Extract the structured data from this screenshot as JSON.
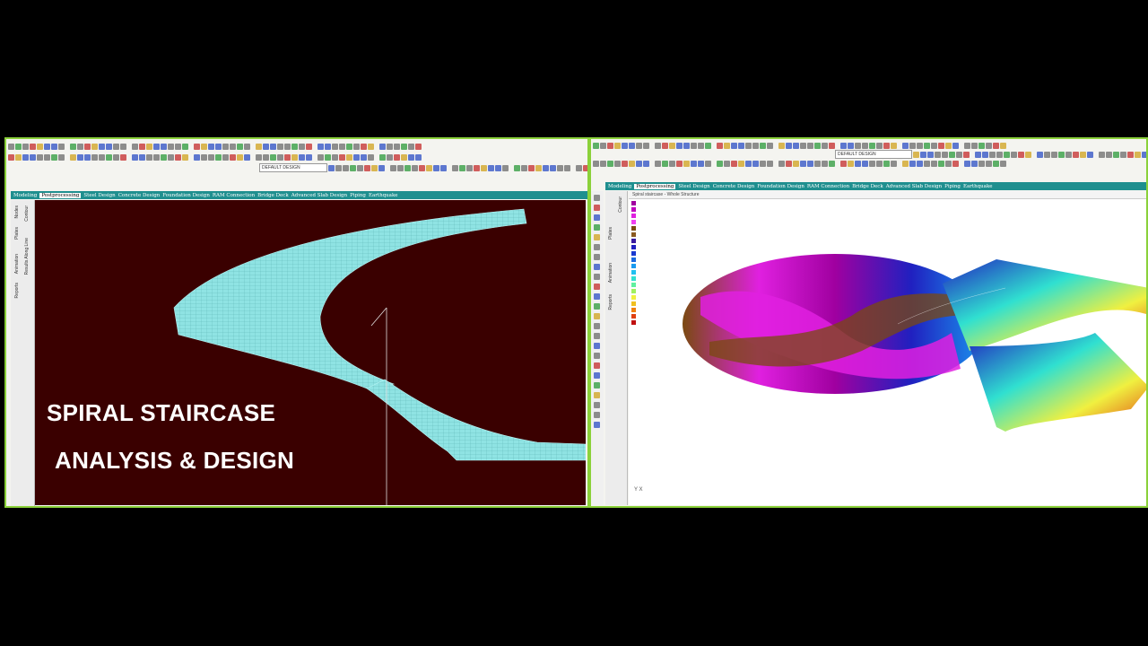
{
  "left_window": {
    "toolbar_combo": "DEFAULT DESIGN",
    "tabs": [
      "Modeling",
      "Postprocessing",
      "Steel Design",
      "Concrete Design",
      "Foundation Design",
      "RAM Connection",
      "Bridge Deck",
      "Advanced Slab Design",
      "Piping",
      "Earthquake"
    ],
    "active_tab": "Postprocessing",
    "side_labels": [
      "Nodes",
      "Plates",
      "Animation",
      "Reports",
      "Contour",
      "Results Along Line"
    ],
    "headline_line1": "SPIRAL STAIRCASE",
    "headline_line2": "ANALYSIS & DESIGN",
    "colors": {
      "viewport": "#3a0000",
      "model": "#8fe3e3",
      "frame": "#8bd13a",
      "tabbar": "#1f8f8f"
    }
  },
  "right_window": {
    "toolbar_combo": "DEFAULT DESIGN",
    "tabs": [
      "Modeling",
      "Postprocessing",
      "Steel Design",
      "Concrete Design",
      "Foundation Design",
      "RAM Connection",
      "Bridge Deck",
      "Advanced Slab Design",
      "Piping",
      "Earthquake"
    ],
    "active_tab": "Postprocessing",
    "side_labels": [
      "Plates",
      "Animation",
      "Reports",
      "Contour"
    ],
    "viewport_title": "Spiral staircase - Whole Structure",
    "legend_colors": [
      "#a000a0",
      "#c000c0",
      "#e020e0",
      "#f040f0",
      "#7a4a10",
      "#8a5a20",
      "#3a1aa0",
      "#2020c0",
      "#1a3ad0",
      "#1a6ae0",
      "#1a9af0",
      "#20c0f0",
      "#30e0d0",
      "#60f0a0",
      "#a0f060",
      "#f0f040",
      "#f0c020",
      "#f08010",
      "#e04010",
      "#c01010"
    ],
    "axis_label": "Y X"
  }
}
